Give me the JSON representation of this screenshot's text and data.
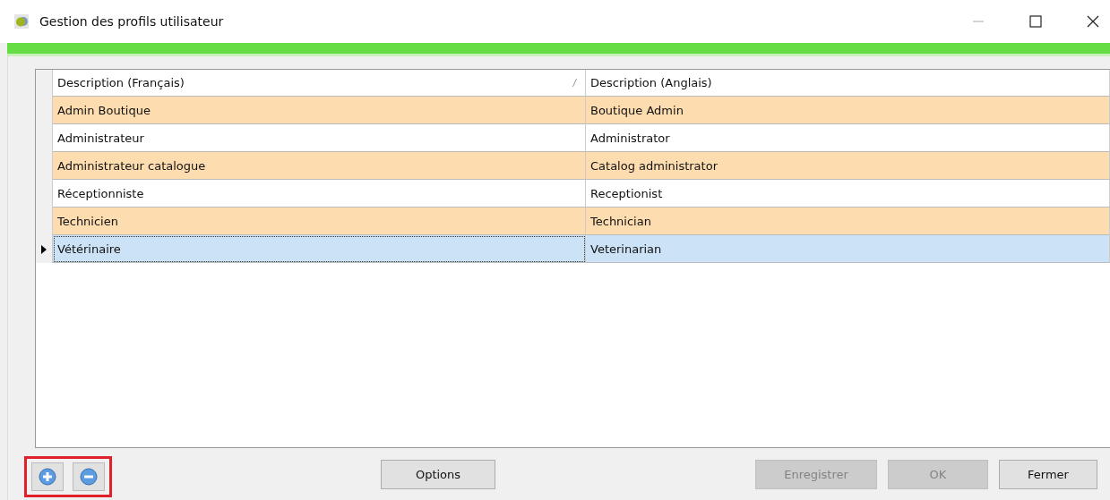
{
  "window": {
    "title": "Gestion des profils utilisateur"
  },
  "table": {
    "columns": [
      {
        "label": "Description (Français)",
        "sort_mark": "/"
      },
      {
        "label": "Description (Anglais)"
      }
    ],
    "rows": [
      {
        "cells": [
          "Admin Boutique",
          "Boutique Admin"
        ],
        "selected": false
      },
      {
        "cells": [
          "Administrateur",
          "Administrator"
        ],
        "selected": false
      },
      {
        "cells": [
          "Administrateur catalogue",
          "Catalog administrator"
        ],
        "selected": false
      },
      {
        "cells": [
          "Réceptionniste",
          "Receptionist"
        ],
        "selected": false
      },
      {
        "cells": [
          "Technicien",
          "Technician"
        ],
        "selected": false
      },
      {
        "cells": [
          "Vétérinaire",
          "Veterinarian"
        ],
        "selected": true
      }
    ]
  },
  "row_buttons": {
    "highlighted": true
  },
  "progress": {
    "level": 1
  },
  "buttons": [
    {
      "label": "Options",
      "disabled": false
    },
    {
      "label": "Enregistrer",
      "disabled": true
    },
    {
      "label": "OK",
      "disabled": true
    },
    {
      "label": "Fermer",
      "disabled": false
    }
  ]
}
